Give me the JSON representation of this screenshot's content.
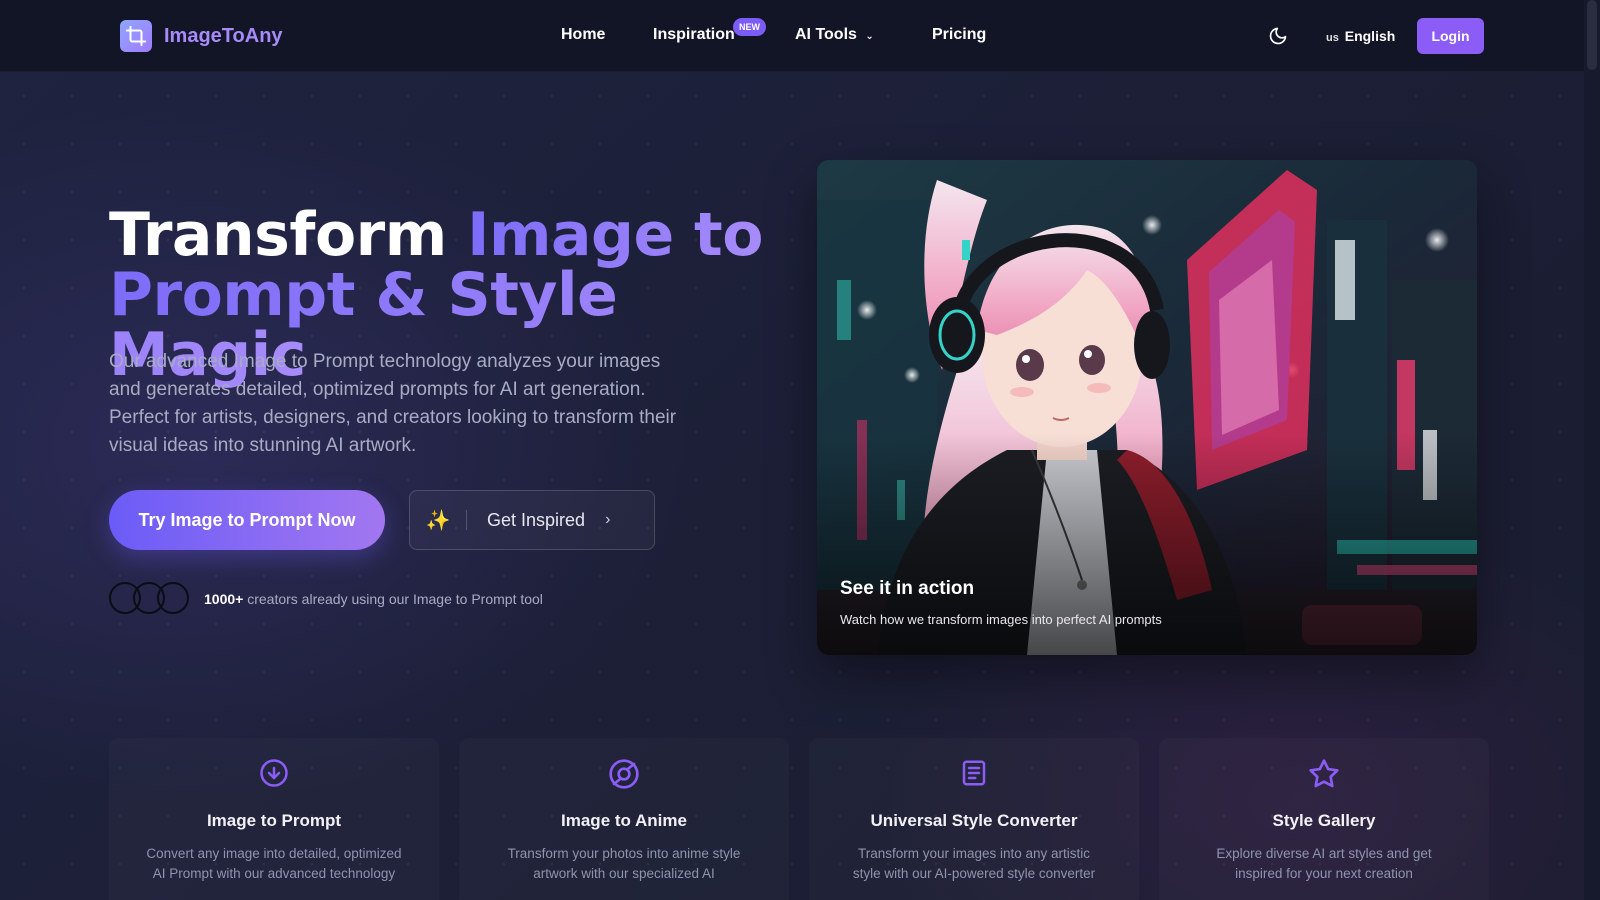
{
  "brand": {
    "name": "ImageToAny"
  },
  "nav": {
    "home": "Home",
    "inspiration": "Inspiration",
    "new_badge": "NEW",
    "ai_tools": "AI Tools",
    "pricing": "Pricing",
    "language_flag": "us",
    "language": "English",
    "login": "Login"
  },
  "hero": {
    "title_white": "Transform ",
    "title_gradient_1": "Image to",
    "title_gradient_2": "Prompt & Style Magic",
    "description": "Our advanced Image to Prompt technology analyzes your images and generates detailed, optimized prompts for AI art generation. Perfect for artists, designers, and creators looking to transform their visual ideas into stunning AI artwork.",
    "cta_primary": "Try Image to Prompt Now",
    "cta_secondary": "Get Inspired",
    "social_count": "1000+",
    "social_text": " creators already using our Image to Prompt tool"
  },
  "showcase": {
    "title": "See it in action",
    "subtitle": "Watch how we transform images into perfect AI prompts"
  },
  "features": [
    {
      "icon": "download-circle-icon",
      "title": "Image to Prompt",
      "line1": "Convert any image into detailed, optimized",
      "line2": "AI Prompt with our advanced technology"
    },
    {
      "icon": "aperture-icon",
      "title": "Image to Anime",
      "line1": "Transform your photos into anime style",
      "line2": "artwork with our specialized AI"
    },
    {
      "icon": "document-icon",
      "title": "Universal Style Converter",
      "line1": "Transform your images into any artistic",
      "line2": "style with our AI-powered style converter"
    },
    {
      "icon": "star-icon",
      "title": "Style Gallery",
      "line1": "Explore diverse AI art styles and get",
      "line2": "inspired for your next creation"
    }
  ],
  "colors": {
    "accent": "#8b5cf6",
    "gradient_start": "#6b5cf7",
    "gradient_end": "#a78bfa",
    "nav_bg": "#121526",
    "page_bg": "#1b1e33"
  }
}
